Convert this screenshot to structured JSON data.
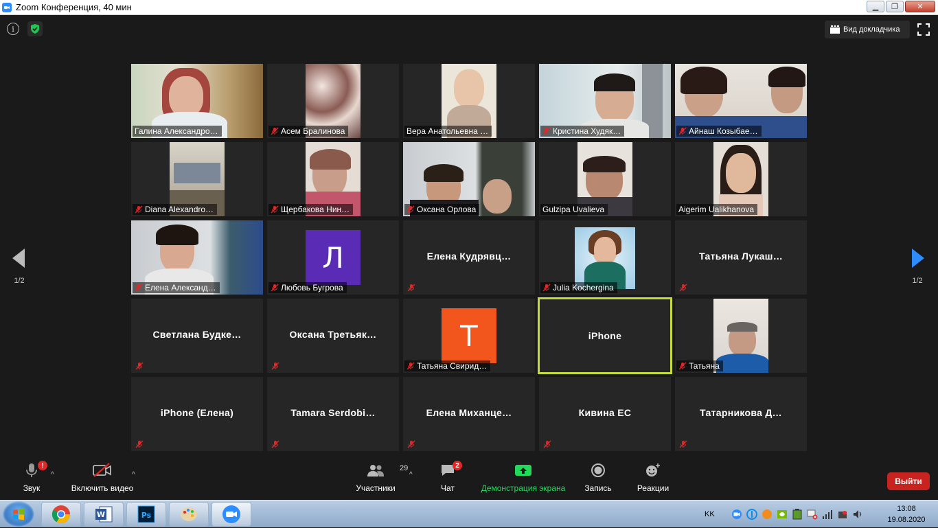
{
  "window": {
    "title": "Zoom Конференция, 40 мин"
  },
  "topbar": {
    "speaker_view_label": "Вид докладчика"
  },
  "pagination": {
    "left": "1/2",
    "right": "1/2"
  },
  "tiles": [
    {
      "name": "Галина Александро…",
      "muted": false
    },
    {
      "name": "Асем Бралинова",
      "muted": true
    },
    {
      "name": "Вера Анатольевна …",
      "muted": false
    },
    {
      "name": "Кристина Худяк…",
      "muted": true
    },
    {
      "name": "Айнаш Козыбае…",
      "muted": true
    },
    {
      "name": "Diana Alexandro…",
      "muted": true
    },
    {
      "name": "Щербакова Нин…",
      "muted": true
    },
    {
      "name": "Оксана Орлова",
      "muted": true
    },
    {
      "name": "Gulzipa Uvalieva",
      "muted": false
    },
    {
      "name": "Aigerim Ualikhanova",
      "muted": false
    },
    {
      "name": "Елена Александ…",
      "muted": true
    },
    {
      "name": "Любовь Бугрова",
      "muted": true,
      "avatar_letter": "Л",
      "avatar_color": "#5a2bb5"
    },
    {
      "name": "Елена Кудрявц…",
      "muted": true
    },
    {
      "name": "Julia Kochergina",
      "muted": true
    },
    {
      "name": "Татьяна Лукаш…",
      "muted": true
    },
    {
      "name": "Светлана Будке…",
      "muted": true
    },
    {
      "name": "Оксана Третьяк…",
      "muted": true
    },
    {
      "name": "Татьяна Свирид…",
      "muted": true,
      "avatar_letter": "Т",
      "avatar_color": "#f2561d"
    },
    {
      "name": "iPhone",
      "muted": false,
      "active": true
    },
    {
      "name": "Татьяна",
      "muted": true
    },
    {
      "name": "iPhone (Елена)",
      "muted": true
    },
    {
      "name": "Tamara Serdobi…",
      "muted": true
    },
    {
      "name": "Елена Миханце…",
      "muted": true
    },
    {
      "name": "Кивина ЕС",
      "muted": true
    },
    {
      "name": "Татарникова Д…",
      "muted": true
    }
  ],
  "toolbar": {
    "audio": {
      "label": "Звук",
      "badge": "!"
    },
    "video": {
      "label": "Включить видео"
    },
    "participants": {
      "label": "Участники",
      "count": "29"
    },
    "chat": {
      "label": "Чат",
      "badge": "2"
    },
    "share": {
      "label": "Демонстрация экрана",
      "color": "#23d959"
    },
    "record": {
      "label": "Запись"
    },
    "reactions": {
      "label": "Реакции"
    },
    "leave": {
      "label": "Выйти",
      "color": "#c8241f"
    }
  },
  "taskbar": {
    "lang": "KK",
    "time": "13:08",
    "date": "19.08.2020"
  }
}
